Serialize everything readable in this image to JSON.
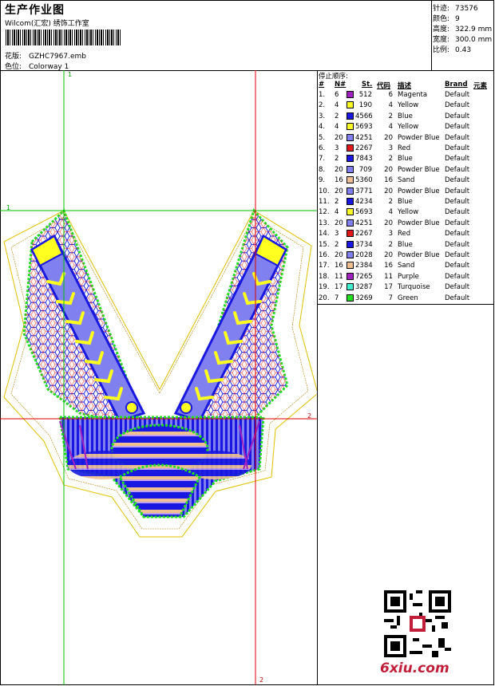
{
  "header": {
    "title": "生产作业图",
    "company": "Wilcom(汇宏) 绣饰工作室",
    "design_label": "花版:",
    "design_value": "GZHC7967.emb",
    "colorway_label": "色位:",
    "colorway_value": "Colorway 1"
  },
  "stats": [
    {
      "label": "针迹:",
      "value": "73576"
    },
    {
      "label": "颜色:",
      "value": "9"
    },
    {
      "label": "高度:",
      "value": "322.9 mm"
    },
    {
      "label": "宽度:",
      "value": "300.0 mm"
    },
    {
      "label": "比例:",
      "value": "0.43"
    }
  ],
  "color_sequence": {
    "title": "停止顺序:",
    "headers": {
      "num": "#",
      "needle": "N#",
      "stitches": "St.",
      "code": "代码",
      "description": "描述",
      "brand": "Brand",
      "elements": "元素"
    },
    "rows": [
      {
        "num": "1.",
        "needle": "6",
        "color": "#a020c0",
        "stitches": "512",
        "code": "6",
        "desc": "Magenta",
        "brand": "Default"
      },
      {
        "num": "2.",
        "needle": "4",
        "color": "#ffff20",
        "stitches": "190",
        "code": "4",
        "desc": "Yellow",
        "brand": "Default"
      },
      {
        "num": "3.",
        "needle": "2",
        "color": "#1818e0",
        "stitches": "4566",
        "code": "2",
        "desc": "Blue",
        "brand": "Default"
      },
      {
        "num": "4.",
        "needle": "4",
        "color": "#ffff20",
        "stitches": "5693",
        "code": "4",
        "desc": "Yellow",
        "brand": "Default"
      },
      {
        "num": "5.",
        "needle": "20",
        "color": "#8080f0",
        "stitches": "4251",
        "code": "20",
        "desc": "Powder Blue",
        "brand": "Default"
      },
      {
        "num": "6.",
        "needle": "3",
        "color": "#e01818",
        "stitches": "2267",
        "code": "3",
        "desc": "Red",
        "brand": "Default"
      },
      {
        "num": "7.",
        "needle": "2",
        "color": "#1818e0",
        "stitches": "7843",
        "code": "2",
        "desc": "Blue",
        "brand": "Default"
      },
      {
        "num": "8.",
        "needle": "20",
        "color": "#8080f0",
        "stitches": "709",
        "code": "20",
        "desc": "Powder Blue",
        "brand": "Default"
      },
      {
        "num": "9.",
        "needle": "16",
        "color": "#f0c090",
        "stitches": "5360",
        "code": "16",
        "desc": "Sand",
        "brand": "Default"
      },
      {
        "num": "10.",
        "needle": "20",
        "color": "#8080f0",
        "stitches": "3771",
        "code": "20",
        "desc": "Powder Blue",
        "brand": "Default"
      },
      {
        "num": "11.",
        "needle": "2",
        "color": "#1818e0",
        "stitches": "4234",
        "code": "2",
        "desc": "Blue",
        "brand": "Default"
      },
      {
        "num": "12.",
        "needle": "4",
        "color": "#ffff20",
        "stitches": "5693",
        "code": "4",
        "desc": "Yellow",
        "brand": "Default"
      },
      {
        "num": "13.",
        "needle": "20",
        "color": "#8080f0",
        "stitches": "4251",
        "code": "20",
        "desc": "Powder Blue",
        "brand": "Default"
      },
      {
        "num": "14.",
        "needle": "3",
        "color": "#e01818",
        "stitches": "2267",
        "code": "3",
        "desc": "Red",
        "brand": "Default"
      },
      {
        "num": "15.",
        "needle": "2",
        "color": "#1818e0",
        "stitches": "3734",
        "code": "2",
        "desc": "Blue",
        "brand": "Default"
      },
      {
        "num": "16.",
        "needle": "20",
        "color": "#8080f0",
        "stitches": "2028",
        "code": "20",
        "desc": "Powder Blue",
        "brand": "Default"
      },
      {
        "num": "17.",
        "needle": "16",
        "color": "#f0c090",
        "stitches": "2384",
        "code": "16",
        "desc": "Sand",
        "brand": "Default"
      },
      {
        "num": "18.",
        "needle": "11",
        "color": "#a020c0",
        "stitches": "7265",
        "code": "11",
        "desc": "Purple",
        "brand": "Default"
      },
      {
        "num": "19.",
        "needle": "17",
        "color": "#40f0d0",
        "stitches": "3287",
        "code": "17",
        "desc": "Turquoise",
        "brand": "Default"
      },
      {
        "num": "20.",
        "needle": "7",
        "color": "#20e020",
        "stitches": "3269",
        "code": "7",
        "desc": "Green",
        "brand": "Default"
      }
    ]
  },
  "axis_labels": {
    "top_x": "1",
    "left_y": "1",
    "right_y": "2",
    "bottom_x": "2"
  },
  "watermark": "6xiu.com",
  "colors": {
    "guide_green": "#00c000",
    "guide_red": "#e00000",
    "outline": "#e0c000"
  }
}
